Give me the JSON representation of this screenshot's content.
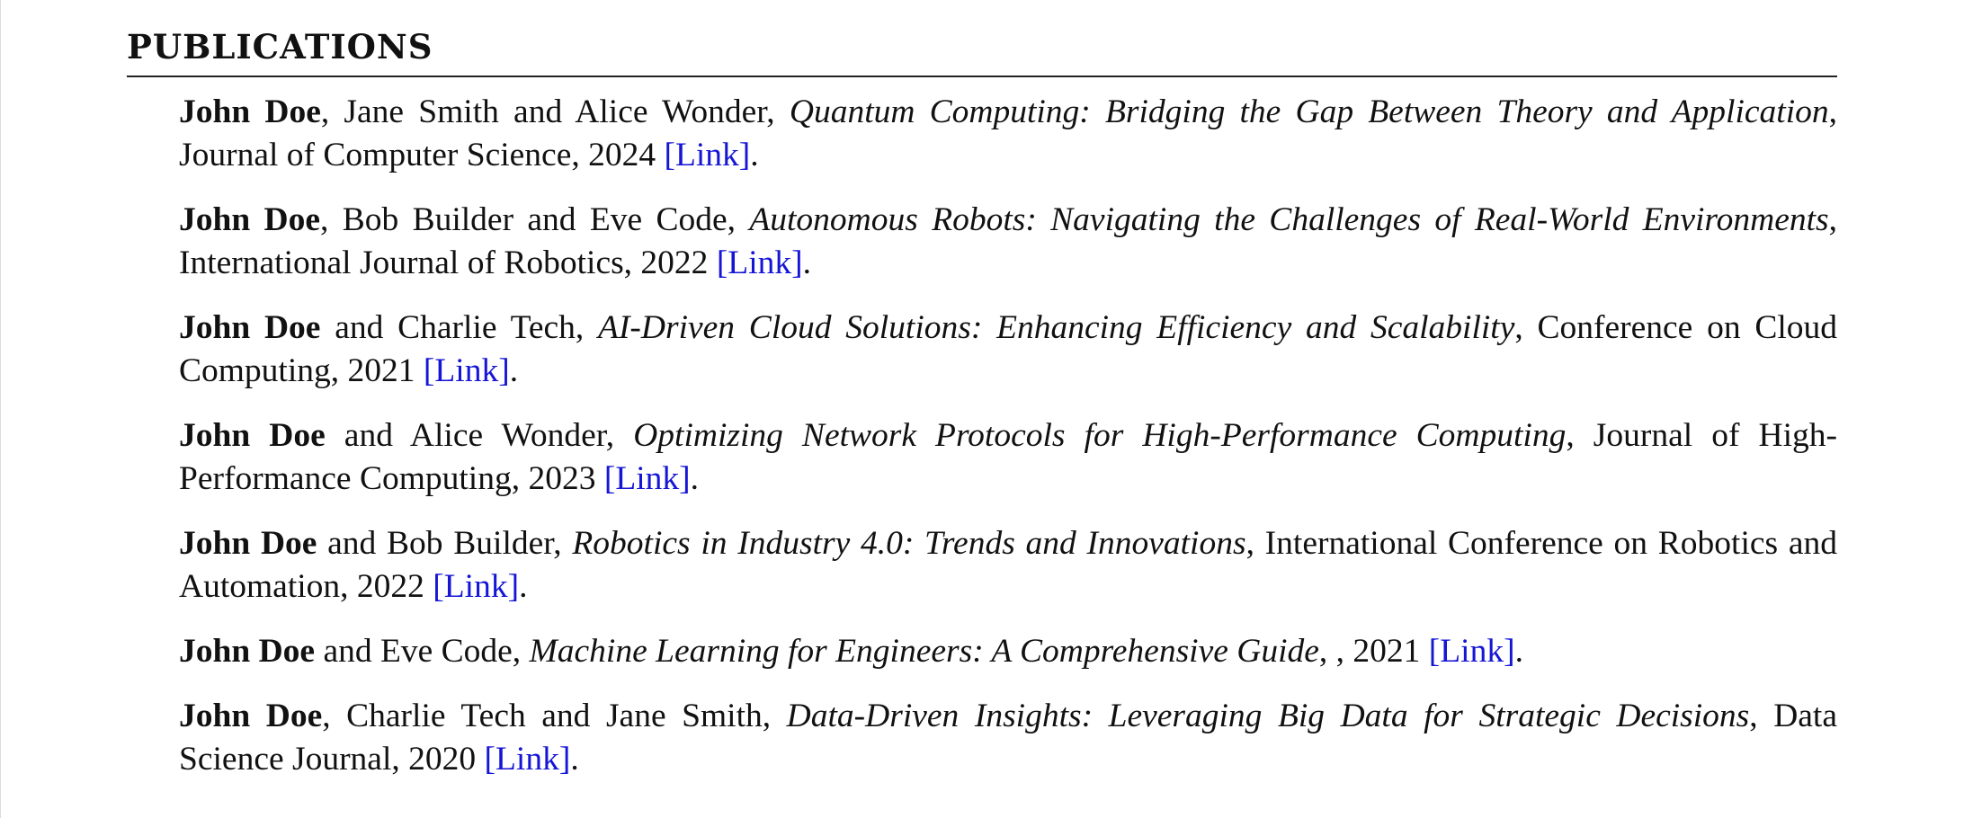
{
  "section": {
    "title": "PUBLICATIONS"
  },
  "publications": [
    {
      "lead_author": "John Doe",
      "coauthors": ", Jane Smith and Alice Wonder, ",
      "title": "Quantum Computing: Bridging the Gap Between Theory and Application",
      "venue_year": ", Journal of Computer Science, 2024 ",
      "link_label": "[Link]",
      "end": "."
    },
    {
      "lead_author": "John Doe",
      "coauthors": ", Bob Builder and Eve Code, ",
      "title": "Autonomous Robots: Navigating the Challenges of Real-World Environments",
      "venue_year": ", International Journal of Robotics, 2022 ",
      "link_label": "[Link]",
      "end": "."
    },
    {
      "lead_author": "John Doe",
      "coauthors": " and Charlie Tech, ",
      "title": "AI-Driven Cloud Solutions: Enhancing Efficiency and Scalability",
      "venue_year": ", Conference on Cloud Computing, 2021 ",
      "link_label": "[Link]",
      "end": "."
    },
    {
      "lead_author": "John Doe",
      "coauthors": " and Alice Wonder, ",
      "title": "Optimizing Network Protocols for High-Performance Computing",
      "venue_year": ", Journal of High-Performance Computing, 2023 ",
      "link_label": "[Link]",
      "end": "."
    },
    {
      "lead_author": "John Doe",
      "coauthors": " and Bob Builder, ",
      "title": "Robotics in Industry 4.0: Trends and Innovations",
      "venue_year": ", International Conference on Robotics and Automation, 2022 ",
      "link_label": "[Link]",
      "end": "."
    },
    {
      "lead_author": "John Doe",
      "coauthors": " and Eve Code, ",
      "title": "Machine Learning for Engineers: A Comprehensive Guide",
      "venue_year": ", , 2021 ",
      "link_label": "[Link]",
      "end": "."
    },
    {
      "lead_author": "John Doe",
      "coauthors": ", Charlie Tech and Jane Smith, ",
      "title": "Data-Driven Insights: Leveraging Big Data for Strategic Decisions",
      "venue_year": ", Data Science Journal, 2020 ",
      "link_label": "[Link]",
      "end": "."
    }
  ]
}
